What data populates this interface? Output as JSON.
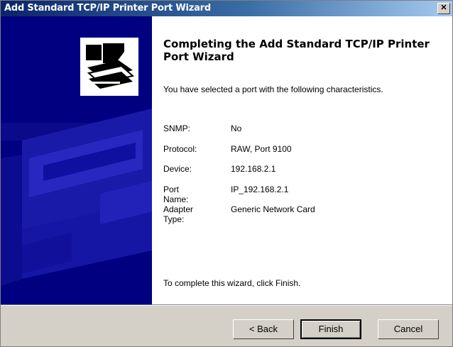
{
  "window": {
    "title": "Add Standard TCP/IP Printer Port Wizard",
    "close_glyph": "✕"
  },
  "colors": {
    "title_bar_start": "#0a246a",
    "title_bar_end": "#a6caf0",
    "side_panel": "#000080",
    "dialog_face": "#d4d0c8"
  },
  "icons": {
    "wizard_logo": "printer-wizard-icon",
    "side_art": "printer-illustration"
  },
  "main": {
    "heading": "Completing the Add Standard TCP/IP Printer Port Wizard",
    "intro": "You have selected a port with the following characteristics.",
    "properties": [
      {
        "label": "SNMP:",
        "value": "No"
      },
      {
        "label": "Protocol:",
        "value": "RAW, Port 9100"
      },
      {
        "label": "Device:",
        "value": "192.168.2.1"
      },
      {
        "label": "Port Name:",
        "value": "IP_192.168.2.1"
      },
      {
        "label": "Adapter Type:",
        "value": "Generic Network Card"
      }
    ],
    "finish_note": "To complete this wizard, click Finish."
  },
  "buttons": {
    "back": "< Back",
    "finish": "Finish",
    "cancel": "Cancel"
  }
}
